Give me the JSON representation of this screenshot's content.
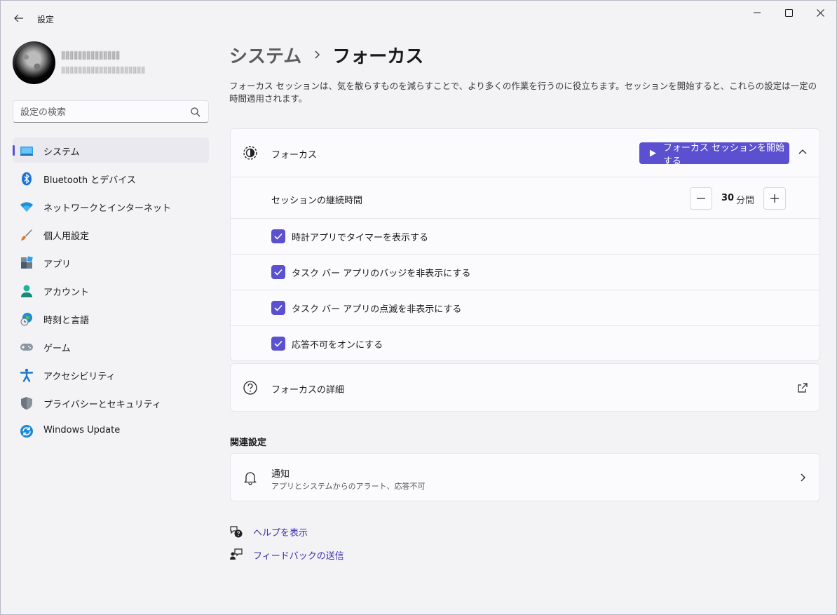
{
  "window": {
    "title": "設定",
    "back_icon": "arrow-left-icon",
    "controls": [
      "minimize-icon",
      "maximize-icon",
      "close-icon"
    ]
  },
  "search": {
    "placeholder": "設定の検索",
    "value": ""
  },
  "sidebar": {
    "items": [
      {
        "label": "システム",
        "icon": "system-icon",
        "active": true
      },
      {
        "label": "Bluetooth とデバイス",
        "icon": "bluetooth-icon"
      },
      {
        "label": "ネットワークとインターネット",
        "icon": "wifi-icon"
      },
      {
        "label": "個人用設定",
        "icon": "paintbrush-icon"
      },
      {
        "label": "アプリ",
        "icon": "apps-icon"
      },
      {
        "label": "アカウント",
        "icon": "account-icon"
      },
      {
        "label": "時刻と言語",
        "icon": "time-language-icon"
      },
      {
        "label": "ゲーム",
        "icon": "gamepad-icon"
      },
      {
        "label": "アクセシビリティ",
        "icon": "accessibility-icon"
      },
      {
        "label": "プライバシーとセキュリティ",
        "icon": "shield-icon"
      },
      {
        "label": "Windows Update",
        "icon": "update-icon"
      }
    ]
  },
  "breadcrumb": {
    "parent": "システム",
    "current": "フォーカス"
  },
  "description": "フォーカス セッションは、気を散らすものを減らすことで、より多くの作業を行うのに役立ちます。セッションを開始すると、これらの設定は一定の時間適用されます。",
  "focus": {
    "label": "フォーカス",
    "start_button": "フォーカス セッションを開始する",
    "duration_label": "セッションの継続時間",
    "duration_value": "30",
    "duration_unit": "分間",
    "options": [
      {
        "label": "時計アプリでタイマーを表示する",
        "checked": true
      },
      {
        "label": "タスク バー アプリのバッジを非表示にする",
        "checked": true
      },
      {
        "label": "タスク バー アプリの点滅を非表示にする",
        "checked": true
      },
      {
        "label": "応答不可をオンにする",
        "checked": true
      }
    ]
  },
  "details": {
    "label": "フォーカスの詳細"
  },
  "related": {
    "title": "関連設定",
    "notifications": {
      "label": "通知",
      "sub": "アプリとシステムからのアラート、応答不可"
    }
  },
  "links": {
    "help": "ヘルプを表示",
    "feedback": "フィードバックの送信"
  },
  "colors": {
    "accent": "#5b50cf",
    "link": "#3a2ea8"
  }
}
